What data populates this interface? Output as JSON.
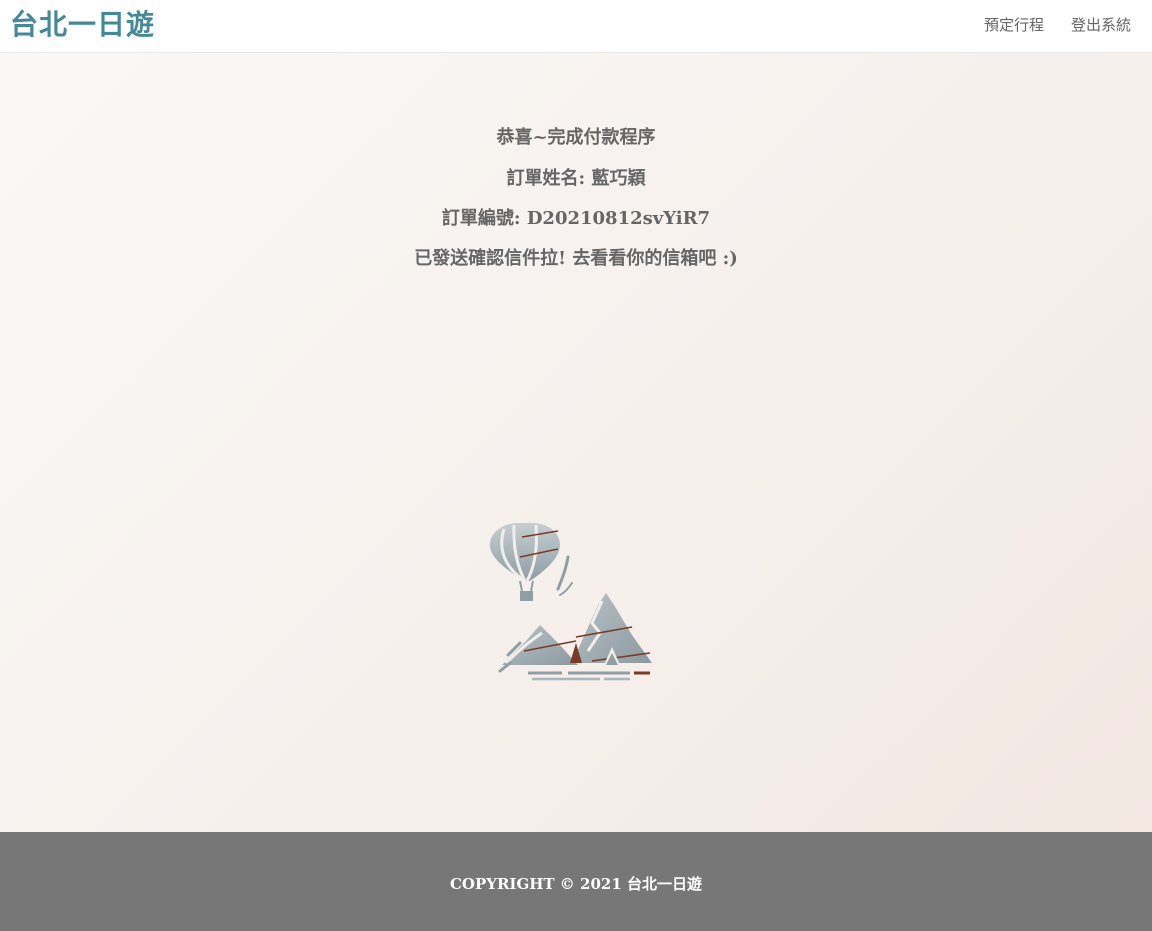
{
  "navbar": {
    "brand": "台北一日遊",
    "links": [
      {
        "label": "預定行程"
      },
      {
        "label": "登出系統"
      }
    ]
  },
  "confirmation": {
    "title": "恭喜~完成付款程序",
    "name_line": "訂單姓名: 藍巧穎",
    "order_line": "訂單編號: D20210812svYiR7",
    "email_line": "已發送確認信件拉! 去看看你的信箱吧 :)"
  },
  "illustration": {
    "icon": "hot-air-balloon-mountains-icon"
  },
  "footer": {
    "copyright": "COPYRIGHT © 2021 台北一日遊"
  },
  "colors": {
    "brand": "#448899",
    "text": "#666666",
    "footer_bg": "#777777",
    "illustration_main": "#a9b6bb",
    "illustration_accent": "#7a3b26"
  }
}
